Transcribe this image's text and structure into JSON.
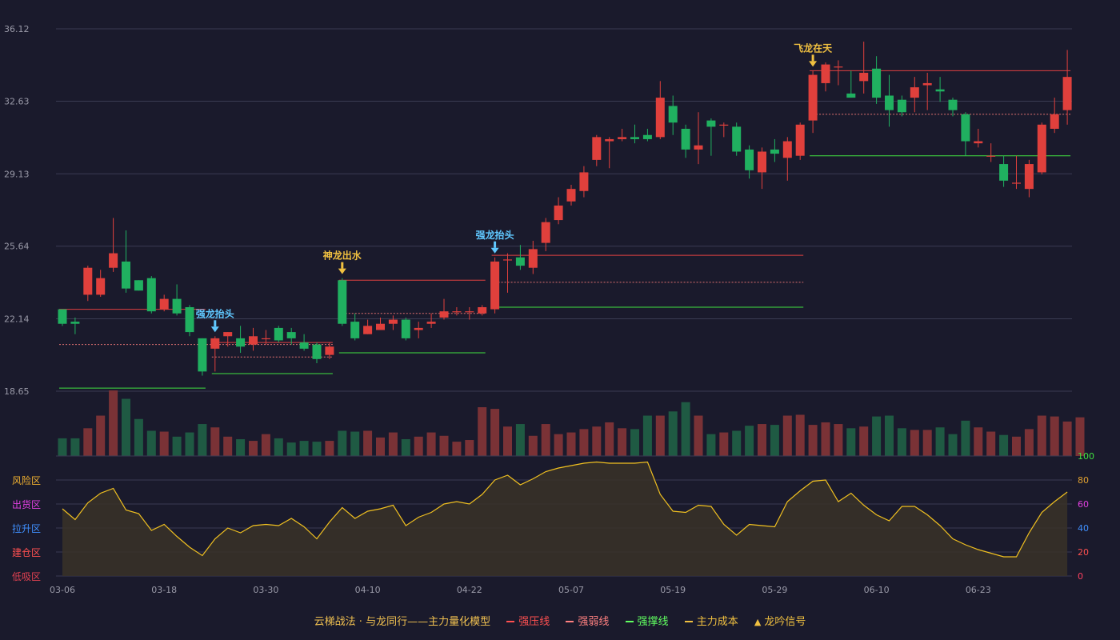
{
  "chart_data": {
    "type": "candlestick",
    "y_ticks": [
      "36.12",
      "32.63",
      "29.13",
      "25.64",
      "22.14",
      "18.65"
    ],
    "ylim": [
      18.65,
      36.12
    ],
    "x_ticks": [
      "03-06",
      "03-18",
      "03-30",
      "04-10",
      "04-22",
      "05-07",
      "05-19",
      "05-29",
      "06-10",
      "06-23"
    ],
    "x_tick_index": [
      0,
      8,
      16,
      24,
      32,
      40,
      48,
      56,
      64,
      72
    ],
    "candles": [
      [
        22.6,
        21.9,
        22.6,
        21.8
      ],
      [
        22.0,
        21.9,
        22.2,
        21.4
      ],
      [
        23.3,
        24.6,
        24.7,
        23.0
      ],
      [
        23.3,
        24.1,
        24.5,
        23.2
      ],
      [
        24.6,
        25.3,
        27.0,
        24.4
      ],
      [
        24.9,
        23.6,
        26.4,
        23.4
      ],
      [
        24.0,
        23.5,
        24.0,
        23.5
      ],
      [
        24.1,
        22.5,
        24.2,
        22.4
      ],
      [
        22.6,
        23.1,
        23.3,
        22.5
      ],
      [
        23.1,
        22.4,
        23.8,
        22.3
      ],
      [
        22.7,
        21.5,
        22.8,
        21.3
      ],
      [
        21.2,
        19.6,
        21.2,
        19.4
      ],
      [
        20.7,
        21.2,
        21.3,
        19.6
      ],
      [
        21.3,
        21.5,
        21.5,
        20.8
      ],
      [
        21.2,
        20.8,
        21.8,
        20.5
      ],
      [
        20.9,
        21.3,
        21.7,
        20.6
      ],
      [
        21.2,
        21.2,
        21.6,
        20.9
      ],
      [
        21.7,
        21.1,
        21.8,
        21.0
      ],
      [
        21.5,
        21.2,
        21.7,
        20.9
      ],
      [
        21.0,
        20.7,
        21.4,
        20.6
      ],
      [
        20.9,
        20.2,
        21.0,
        20.0
      ],
      [
        20.4,
        20.8,
        21.0,
        20.2
      ],
      [
        24.0,
        21.9,
        24.1,
        21.8
      ],
      [
        22.0,
        21.2,
        22.4,
        21.1
      ],
      [
        21.4,
        21.8,
        22.1,
        21.4
      ],
      [
        21.6,
        21.9,
        22.2,
        21.6
      ],
      [
        21.9,
        22.1,
        22.3,
        21.6
      ],
      [
        22.1,
        21.2,
        22.2,
        21.1
      ],
      [
        21.6,
        21.7,
        22.0,
        21.2
      ],
      [
        21.9,
        22.0,
        22.4,
        21.7
      ],
      [
        22.2,
        22.5,
        23.1,
        22.1
      ],
      [
        22.5,
        22.5,
        22.7,
        22.3
      ],
      [
        22.5,
        22.5,
        22.7,
        22.1
      ],
      [
        22.4,
        22.7,
        22.8,
        22.3
      ],
      [
        22.6,
        24.9,
        25.1,
        22.4
      ],
      [
        25.0,
        25.0,
        25.3,
        23.4
      ],
      [
        25.1,
        24.7,
        25.7,
        24.5
      ],
      [
        24.6,
        25.5,
        25.9,
        24.3
      ],
      [
        25.8,
        26.8,
        27.0,
        25.4
      ],
      [
        26.9,
        27.6,
        28.0,
        26.7
      ],
      [
        27.8,
        28.4,
        28.6,
        27.6
      ],
      [
        28.3,
        29.2,
        29.5,
        28.0
      ],
      [
        29.8,
        30.9,
        31.0,
        29.5
      ],
      [
        30.7,
        30.8,
        30.9,
        29.4
      ],
      [
        30.8,
        30.9,
        31.3,
        30.7
      ],
      [
        30.9,
        30.8,
        31.5,
        30.6
      ],
      [
        31.0,
        30.8,
        31.3,
        30.7
      ],
      [
        30.9,
        32.8,
        33.6,
        30.8
      ],
      [
        32.4,
        31.6,
        32.9,
        31.0
      ],
      [
        31.3,
        30.3,
        31.5,
        29.9
      ],
      [
        30.3,
        30.5,
        32.1,
        29.6
      ],
      [
        31.7,
        31.4,
        31.8,
        30.0
      ],
      [
        31.5,
        31.5,
        31.6,
        30.9
      ],
      [
        31.4,
        30.2,
        31.6,
        30.0
      ],
      [
        30.3,
        29.3,
        30.5,
        28.9
      ],
      [
        29.2,
        30.2,
        30.4,
        28.4
      ],
      [
        30.3,
        30.1,
        30.8,
        29.7
      ],
      [
        29.9,
        30.7,
        30.9,
        28.8
      ],
      [
        30.0,
        31.5,
        31.6,
        29.8
      ],
      [
        31.7,
        33.9,
        34.1,
        31.1
      ],
      [
        33.5,
        34.4,
        34.5,
        33.1
      ],
      [
        34.3,
        34.3,
        34.6,
        33.4
      ],
      [
        33.0,
        32.8,
        34.1,
        32.8
      ],
      [
        33.6,
        34.0,
        35.5,
        33.0
      ],
      [
        34.2,
        32.8,
        34.8,
        32.5
      ],
      [
        32.9,
        32.2,
        33.9,
        31.4
      ],
      [
        32.7,
        32.1,
        32.9,
        31.9
      ],
      [
        32.8,
        33.3,
        33.8,
        32.1
      ],
      [
        33.4,
        33.5,
        34.0,
        32.2
      ],
      [
        33.2,
        33.1,
        33.8,
        32.6
      ],
      [
        32.7,
        32.2,
        32.8,
        31.9
      ],
      [
        32.0,
        30.7,
        32.1,
        30.0
      ],
      [
        30.6,
        30.7,
        31.3,
        30.4
      ],
      [
        30.0,
        30.0,
        30.6,
        29.7
      ],
      [
        29.6,
        28.8,
        30.0,
        28.5
      ],
      [
        28.7,
        28.7,
        30.0,
        28.4
      ],
      [
        28.4,
        29.6,
        29.8,
        28.0
      ],
      [
        29.2,
        31.5,
        31.6,
        29.1
      ],
      [
        31.3,
        32.0,
        32.8,
        31.1
      ],
      [
        32.2,
        33.8,
        35.1,
        31.5
      ]
    ],
    "volume": [
      21,
      21,
      33,
      48,
      78,
      68,
      44,
      30,
      29,
      23,
      28,
      38,
      34,
      23,
      20,
      18,
      26,
      21,
      16,
      18,
      17,
      18,
      30,
      29,
      30,
      22,
      28,
      20,
      23,
      28,
      24,
      17,
      19,
      58,
      56,
      35,
      38,
      24,
      38,
      26,
      28,
      32,
      35,
      40,
      33,
      32,
      48,
      48,
      53,
      64,
      48,
      26,
      28,
      30,
      36,
      38,
      37,
      48,
      49,
      37,
      40,
      38,
      33,
      35,
      47,
      48,
      33,
      31,
      31,
      34,
      26,
      42,
      34,
      29,
      25,
      23,
      32,
      48,
      47,
      41,
      46
    ],
    "volume_max": 78,
    "oscillator": {
      "values": [
        56,
        47,
        61,
        69,
        73,
        55,
        52,
        38,
        43,
        33,
        24,
        17,
        31,
        40,
        36,
        42,
        43,
        42,
        48,
        41,
        31,
        45,
        57,
        48,
        54,
        56,
        59,
        42,
        49,
        53,
        60,
        62,
        60,
        68,
        80,
        84,
        76,
        81,
        87,
        90,
        92,
        94,
        95,
        94,
        94,
        94,
        95,
        68,
        54,
        53,
        59,
        58,
        43,
        34,
        43,
        42,
        41,
        62,
        71,
        79,
        80,
        62,
        69,
        59,
        51,
        46,
        58,
        58,
        51,
        42,
        31,
        26,
        22,
        19,
        16,
        16,
        36,
        53,
        62,
        70
      ],
      "left_labels": [
        "风险区",
        "出货区",
        "拉升区",
        "建仓区",
        "低吸区"
      ],
      "left_label_colors": [
        "#f0b030",
        "#e040e0",
        "#4090ff",
        "#ff5050",
        "#e04050"
      ],
      "right_ticks": [
        "100",
        "80",
        "60",
        "40",
        "20",
        "0"
      ],
      "right_tick_colors": [
        "#40e040",
        "#e0a030",
        "#e040e0",
        "#4090ff",
        "#ff5050",
        "#ff4060"
      ]
    },
    "levels": [
      {
        "kind": "resist",
        "from": 0,
        "to": 11,
        "value": 22.6
      },
      {
        "kind": "weak",
        "from": 0,
        "to": 21,
        "value": 20.9
      },
      {
        "kind": "support",
        "from": 0,
        "to": 11,
        "value": 18.8
      },
      {
        "kind": "resist",
        "from": 12,
        "to": 21,
        "value": 21.0
      },
      {
        "kind": "weak",
        "from": 12,
        "to": 21,
        "value": 20.3
      },
      {
        "kind": "support",
        "from": 12,
        "to": 21,
        "value": 19.5
      },
      {
        "kind": "resist",
        "from": 22,
        "to": 33,
        "value": 24.0
      },
      {
        "kind": "weak",
        "from": 22,
        "to": 33,
        "value": 22.4
      },
      {
        "kind": "support",
        "from": 22,
        "to": 33,
        "value": 20.5
      },
      {
        "kind": "resist",
        "from": 34,
        "to": 58,
        "value": 25.2
      },
      {
        "kind": "weak",
        "from": 34,
        "to": 58,
        "value": 23.9
      },
      {
        "kind": "support",
        "from": 34,
        "to": 58,
        "value": 22.7
      },
      {
        "kind": "resist",
        "from": 59,
        "to": 79,
        "value": 34.1
      },
      {
        "kind": "weak",
        "from": 59,
        "to": 79,
        "value": 32.0
      },
      {
        "kind": "support",
        "from": 59,
        "to": 79,
        "value": 30.0
      }
    ],
    "signals": [
      {
        "index": 12,
        "text": "强龙抬头",
        "color": "#60c8ff"
      },
      {
        "index": 22,
        "text": "神龙出水",
        "color": "#f0c040"
      },
      {
        "index": 34,
        "text": "强龙抬头",
        "color": "#60c8ff"
      },
      {
        "index": 59,
        "text": "飞龙在天",
        "color": "#f0c040"
      }
    ],
    "colors": {
      "up": "#e0403c",
      "down": "#20b060",
      "vol_up": "#7a3236",
      "vol_down": "#1f5a43",
      "resist": "#e04040",
      "weak": "#e07070",
      "support": "#40e040",
      "osc_line": "#f0c020",
      "osc_fill": "#3a3228",
      "grid": "#3a3b52",
      "axis_text": "#9a9aa8"
    }
  },
  "legend": {
    "title": "云梯战法 · 与龙同行——主力量化模型",
    "items": [
      {
        "label": "强压线",
        "color": "#ff5050",
        "style": "solid"
      },
      {
        "label": "强弱线",
        "color": "#ff8080",
        "style": "dashed"
      },
      {
        "label": "强撑线",
        "color": "#60ff60",
        "style": "solid"
      },
      {
        "label": "主力成本",
        "color": "#f0c040",
        "style": "dashed"
      },
      {
        "label": "龙吟信号",
        "color": "#f0c040",
        "style": "triangle",
        "glyph": "▲"
      }
    ]
  }
}
